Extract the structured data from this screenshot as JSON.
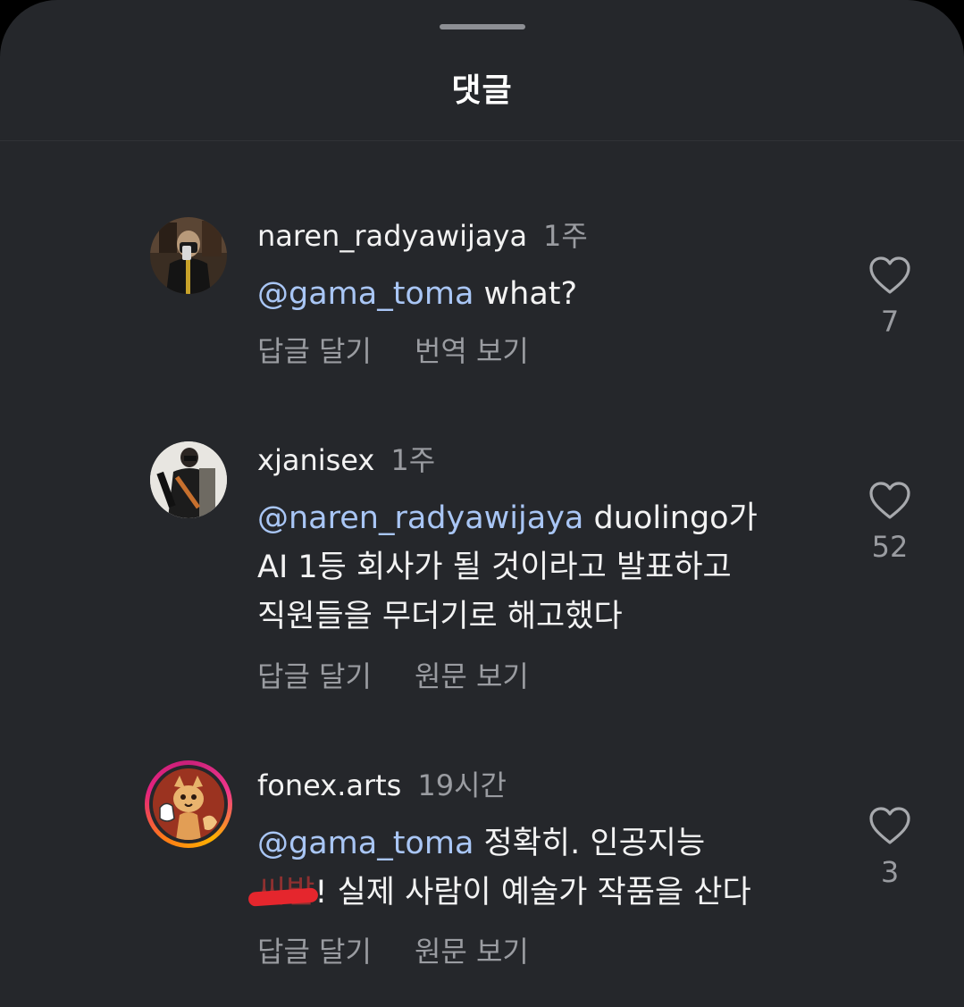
{
  "sheet": {
    "title": "댓글"
  },
  "comments": [
    {
      "username": "naren_radyawijaya",
      "time": "1주",
      "mention": "@gama_toma",
      "text_lines": [
        " what?"
      ],
      "reply_label": "답글 달기",
      "secondary_label": "번역 보기",
      "likes": "7",
      "avatar": "avatar-naren-icon"
    },
    {
      "username": "xjanisex",
      "time": "1주",
      "mention": "@naren_radyawijaya",
      "text_first": " duolingo가",
      "text_lines": [
        "AI 1등 회사가 될 것이라고 발표하고",
        "직원들을 무더기로 해고했다"
      ],
      "reply_label": "답글 달기",
      "secondary_label": "원문 보기",
      "likes": "52",
      "avatar": "avatar-xjanisex-icon"
    },
    {
      "username": "fonex.arts",
      "time": "19시간",
      "mention": "@gama_toma",
      "text_first": " 정확히. 인공지능",
      "redacted_word": "씨발",
      "text_after_redaction": "! 실제 사람이 예술가 작품을 산다",
      "reply_label": "답글 달기",
      "secondary_label": "원문 보기",
      "likes": "3",
      "avatar": "avatar-fonex-icon",
      "has_story_ring": true
    }
  ],
  "colors": {
    "background": "#25272b",
    "mention": "#a9c6f5",
    "muted_text": "#9a9ca1",
    "primary_text": "#f3f3f3"
  }
}
